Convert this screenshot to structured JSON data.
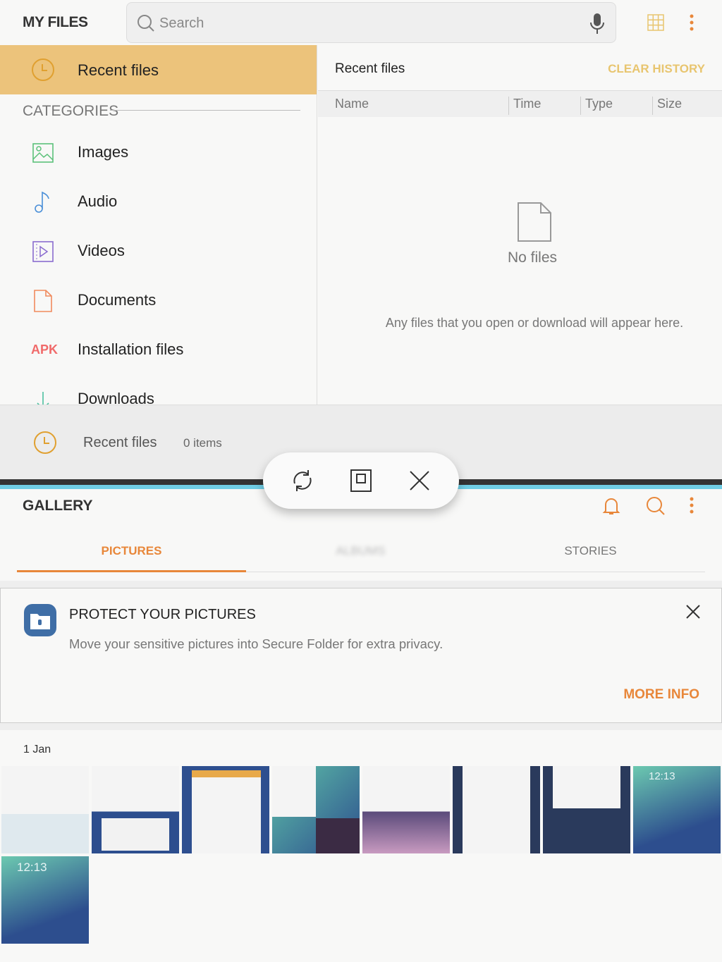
{
  "my_files": {
    "title": "MY FILES",
    "search_placeholder": "Search",
    "sidebar": {
      "selected": "Recent files",
      "categories_label": "CATEGORIES",
      "items": [
        {
          "label": "Images",
          "icon": "image-icon"
        },
        {
          "label": "Audio",
          "icon": "music-note-icon"
        },
        {
          "label": "Videos",
          "icon": "video-icon"
        },
        {
          "label": "Documents",
          "icon": "document-icon"
        },
        {
          "label": "Installation files",
          "icon": "apk-icon",
          "icon_text": "APK"
        },
        {
          "label": "Downloads",
          "icon": "download-icon"
        }
      ]
    },
    "content": {
      "title": "Recent files",
      "clear_history": "CLEAR HISTORY",
      "columns": [
        "Name",
        "Time",
        "Type",
        "Size"
      ],
      "empty_title": "No files",
      "empty_hint": "Any files that you open or download will appear here."
    },
    "bottom_bar": {
      "label": "Recent files",
      "count": "0 items"
    },
    "colors": {
      "accent": "#ecc37b",
      "clear_history": "#e8c56f"
    }
  },
  "split_controls": [
    "swap-windows",
    "maximize",
    "close"
  ],
  "gallery": {
    "title": "GALLERY",
    "tabs": [
      {
        "label": "PICTURES",
        "active": true
      },
      {
        "label": "ALBUMS",
        "active": false
      },
      {
        "label": "STORIES",
        "active": false
      }
    ],
    "card": {
      "title": "PROTECT YOUR PICTURES",
      "text": "Move your sensitive pictures into Secure Folder for extra privacy.",
      "action": "MORE INFO"
    },
    "date_group": "1 Jan",
    "thumbnails": [
      {
        "kind": "myfiles-screenshot"
      },
      {
        "kind": "myfiles-screenshot"
      },
      {
        "kind": "myfiles-screenshot"
      },
      {
        "kind": "split-screenshot"
      },
      {
        "kind": "flower-photo"
      },
      {
        "kind": "settings-screenshot"
      },
      {
        "kind": "settings-screenshot"
      },
      {
        "kind": "home-screenshot",
        "clock": "12:13"
      },
      {
        "kind": "home-screenshot",
        "clock": "12:13"
      }
    ],
    "colors": {
      "accent": "#e8873a",
      "divider": "#6fcde4"
    }
  }
}
